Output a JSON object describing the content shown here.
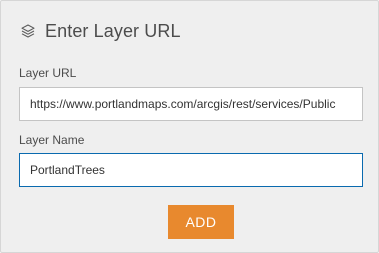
{
  "header": {
    "icon": "layers-icon",
    "title": "Enter Layer URL"
  },
  "form": {
    "url_label": "Layer URL",
    "url_value": "https://www.portlandmaps.com/arcgis/rest/services/Public",
    "name_label": "Layer Name",
    "name_value": "PortlandTrees"
  },
  "actions": {
    "add_label": "ADD"
  },
  "colors": {
    "panel_bg": "#efefef",
    "accent_orange": "#e8892e",
    "focus_blue": "#0a6aaf",
    "text_dark": "#4c4c4c"
  }
}
